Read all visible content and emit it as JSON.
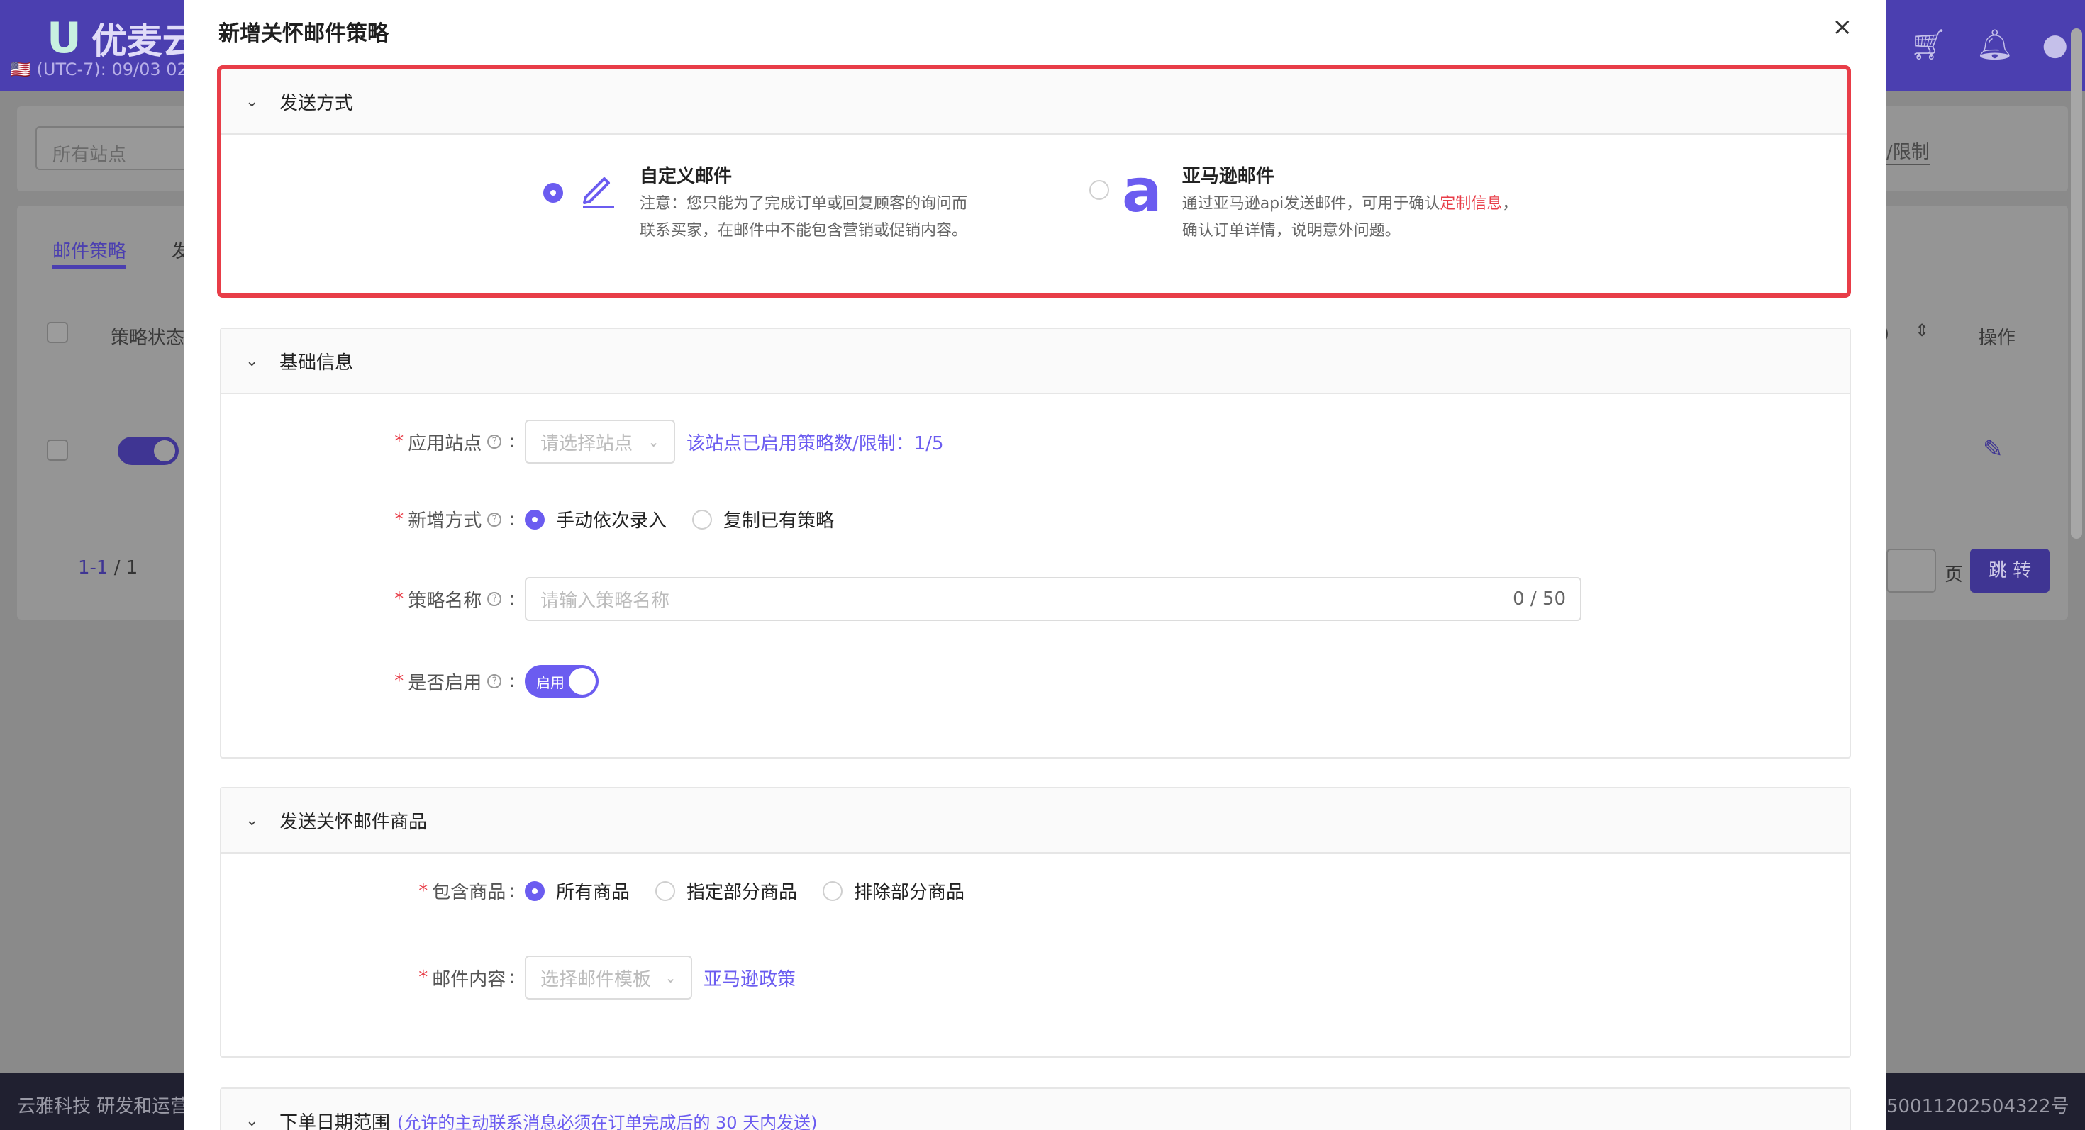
{
  "background": {
    "logo_text": "优麦云",
    "timezone": "🇺🇸 (UTC-7): 09/03 02",
    "filter_placeholder": "所有站点",
    "filter_right_text": "/限制",
    "tabs": [
      "邮件策略",
      "发"
    ],
    "table_headers": {
      "status": "策略状态",
      "action": "操作",
      "sort_hint": ")"
    },
    "pager": {
      "range": "1-1",
      "sep": " / ",
      "total": "1",
      "page_label": "页",
      "jump_label": "跳 转"
    },
    "footer_left": "云雅科技 研发和运营",
    "footer_right": "50011202504322号"
  },
  "modal": {
    "title": "新增关怀邮件策略",
    "close_icon": "×",
    "send_method": {
      "title": "发送方式",
      "custom": {
        "title": "自定义邮件",
        "desc_line1": "注意：您只能为了完成订单或回复顾客的询问而",
        "desc_line2": "联系买家，在邮件中不能包含营销或促销内容。"
      },
      "amazon": {
        "title": "亚马逊邮件",
        "icon_letter": "a",
        "desc_prefix": "通过亚马逊api发送邮件，可用于确认",
        "desc_link": "定制信息",
        "desc_suffix": "，",
        "desc_line2": "确认订单详情，说明意外问题。"
      }
    },
    "basic_info": {
      "title": "基础信息",
      "site": {
        "label": "应用站点",
        "placeholder": "请选择站点",
        "hint": "该站点已启用策略数/限制：1/5"
      },
      "add_mode": {
        "label": "新增方式",
        "options": [
          "手动依次录入",
          "复制已有策略"
        ]
      },
      "name": {
        "label": "策略名称",
        "placeholder": "请输入策略名称",
        "counter": "0 / 50"
      },
      "enabled": {
        "label": "是否启用",
        "switch_text": "启用"
      }
    },
    "products": {
      "title": "发送关怀邮件商品",
      "include": {
        "label": "包含商品",
        "options": [
          "所有商品",
          "指定部分商品",
          "排除部分商品"
        ]
      },
      "content": {
        "label": "邮件内容",
        "placeholder": "选择邮件模板",
        "link": "亚马逊政策"
      }
    },
    "date_range": {
      "title": "下单日期范围",
      "note": "(允许的主动联系消息必须在订单完成后的 30 天内发送)"
    }
  }
}
